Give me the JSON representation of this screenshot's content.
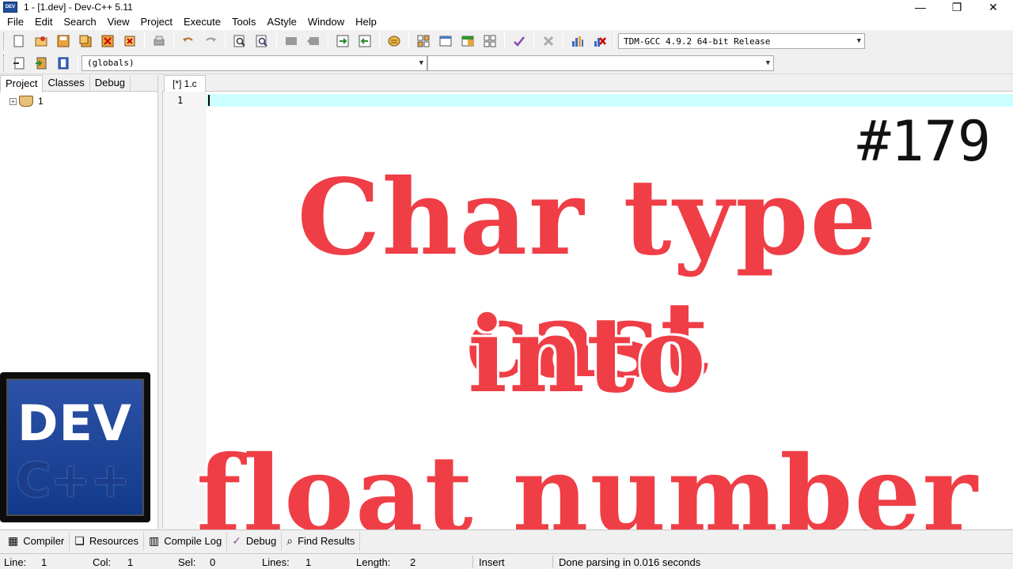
{
  "window": {
    "icon_label": "DEV",
    "title": "1 - [1.dev] - Dev-C++ 5.11",
    "minimize": "—",
    "maximize": "❐",
    "close": "✕"
  },
  "menu": [
    "File",
    "Edit",
    "Search",
    "View",
    "Project",
    "Execute",
    "Tools",
    "AStyle",
    "Window",
    "Help"
  ],
  "toolbar": {
    "compiler_select": "TDM-GCC 4.9.2 64-bit Release",
    "scope_select": "(globals)",
    "function_select": ""
  },
  "left_panel": {
    "tabs": [
      "Project",
      "Classes",
      "Debug"
    ],
    "tree_root": "1"
  },
  "logo": {
    "line1": "DEV",
    "line2": "C++"
  },
  "editor": {
    "tab": "[*] 1.c",
    "line_number": "1"
  },
  "overlay": {
    "episode": "#179",
    "line1": "Char type cast",
    "line2": "into",
    "line3": "float number"
  },
  "bottom_tabs": {
    "compiler": "Compiler",
    "resources": "Resources",
    "compile_log": "Compile Log",
    "debug": "Debug",
    "find_results": "Find Results"
  },
  "status": {
    "line_label": "Line:",
    "line_value": "1",
    "col_label": "Col:",
    "col_value": "1",
    "sel_label": "Sel:",
    "sel_value": "0",
    "lines_label": "Lines:",
    "lines_value": "1",
    "length_label": "Length:",
    "length_value": "2",
    "mode": "Insert",
    "message": "Done parsing in 0.016 seconds"
  },
  "colors": {
    "headline": "#ef3e46",
    "active_line": "#ccffff"
  }
}
